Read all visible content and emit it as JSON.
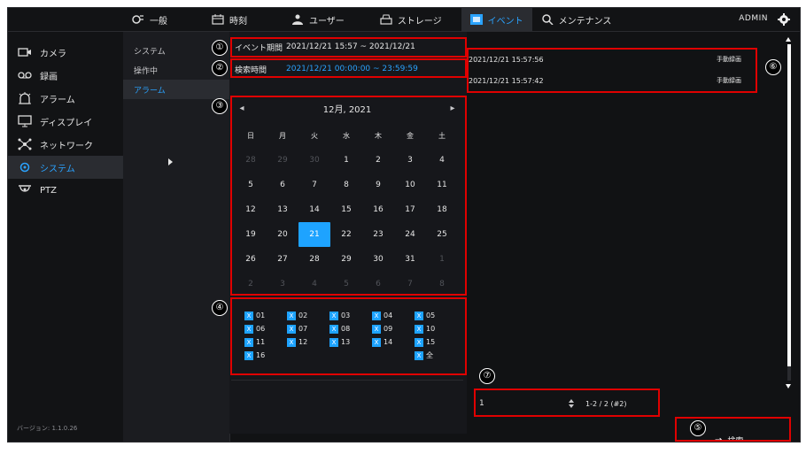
{
  "topnav": {
    "tabs": [
      {
        "label": "一般",
        "icon": "general-icon"
      },
      {
        "label": "時刻",
        "icon": "calendar-icon"
      },
      {
        "label": "ユーザー",
        "icon": "users-icon"
      },
      {
        "label": "ストレージ",
        "icon": "storage-icon"
      },
      {
        "label": "イベント",
        "icon": "event-icon",
        "active": true
      },
      {
        "label": "メンテナンス",
        "icon": "maintenance-icon"
      }
    ],
    "user": "ADMIN"
  },
  "leftnav": {
    "items": [
      {
        "label": "カメラ",
        "icon": "camera-icon"
      },
      {
        "label": "録画",
        "icon": "record-icon"
      },
      {
        "label": "アラーム",
        "icon": "alarm-icon"
      },
      {
        "label": "ディスプレイ",
        "icon": "display-icon"
      },
      {
        "label": "ネットワーク",
        "icon": "network-icon"
      },
      {
        "label": "システム",
        "icon": "system-icon",
        "active": true
      },
      {
        "label": "PTZ",
        "icon": "ptz-icon"
      }
    ],
    "version": "バージョン: 1.1.0.26"
  },
  "subnav": {
    "items": [
      {
        "label": "システム"
      },
      {
        "label": "操作中"
      },
      {
        "label": "アラーム",
        "active": true
      }
    ]
  },
  "event_period": {
    "label": "イベント期間",
    "value": "2021/12/21 15:57 ~ 2021/12/21"
  },
  "search_time": {
    "label": "検索時間",
    "value": "2021/12/21 00:00:00 ~ 23:59:59"
  },
  "calendar": {
    "month_label": "12月, 2021",
    "prev": "◂",
    "next": "▸",
    "weekdays": [
      "日",
      "月",
      "火",
      "水",
      "木",
      "金",
      "土"
    ],
    "days": [
      {
        "d": "28",
        "dim": true
      },
      {
        "d": "29",
        "dim": true
      },
      {
        "d": "30",
        "dim": true
      },
      {
        "d": "1"
      },
      {
        "d": "2"
      },
      {
        "d": "3"
      },
      {
        "d": "4"
      },
      {
        "d": "5"
      },
      {
        "d": "6"
      },
      {
        "d": "7"
      },
      {
        "d": "8"
      },
      {
        "d": "9"
      },
      {
        "d": "10"
      },
      {
        "d": "11"
      },
      {
        "d": "12"
      },
      {
        "d": "13"
      },
      {
        "d": "14"
      },
      {
        "d": "15"
      },
      {
        "d": "16"
      },
      {
        "d": "17"
      },
      {
        "d": "18"
      },
      {
        "d": "19"
      },
      {
        "d": "20"
      },
      {
        "d": "21",
        "selected": true
      },
      {
        "d": "22"
      },
      {
        "d": "23"
      },
      {
        "d": "24"
      },
      {
        "d": "25"
      },
      {
        "d": "26"
      },
      {
        "d": "27"
      },
      {
        "d": "28"
      },
      {
        "d": "29"
      },
      {
        "d": "30"
      },
      {
        "d": "31"
      },
      {
        "d": "1",
        "dim": true
      },
      {
        "d": "2",
        "dim": true
      },
      {
        "d": "3",
        "dim": true
      },
      {
        "d": "4",
        "dim": true
      },
      {
        "d": "5",
        "dim": true
      },
      {
        "d": "6",
        "dim": true
      },
      {
        "d": "7",
        "dim": true
      },
      {
        "d": "8",
        "dim": true
      }
    ]
  },
  "channels": {
    "items": [
      "01",
      "02",
      "03",
      "04",
      "05",
      "06",
      "07",
      "08",
      "09",
      "10",
      "11",
      "12",
      "13",
      "14",
      "15",
      "16"
    ],
    "all_label": "全",
    "check_mark": "X"
  },
  "events": [
    {
      "time": "2021/12/21 15:57:56",
      "type": "手動録画"
    },
    {
      "time": "2021/12/21 15:57:42",
      "type": "手動録画"
    }
  ],
  "pager": {
    "value": "1",
    "count": "1-2 / 2 (#2)"
  },
  "search_button": {
    "label": "検索",
    "arrow": "→"
  },
  "annotations": [
    "①",
    "②",
    "③",
    "④",
    "⑤",
    "⑥",
    "⑦"
  ],
  "colors": {
    "accent": "#1ea3ff",
    "annotation": "#e00000"
  }
}
